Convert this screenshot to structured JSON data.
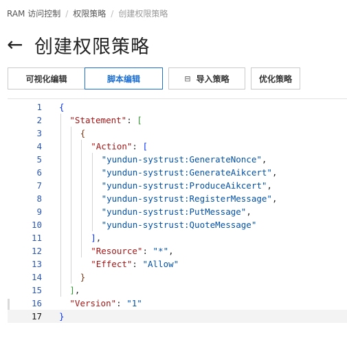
{
  "breadcrumb": {
    "item1": "RAM 访问控制",
    "item2": "权限策略",
    "item3": "创建权限策略",
    "separator": "/"
  },
  "header": {
    "back_arrow": "←",
    "title": "创建权限策略"
  },
  "tabs": {
    "visual_editor": "可视化编辑",
    "script_editor": "脚本编辑",
    "import_policy": "导入策略",
    "import_icon": "⊟",
    "optimize_policy": "优化策略",
    "active": "script_editor"
  },
  "editor": {
    "current_line": 17,
    "lines": [
      {
        "num": "1",
        "tokens": [
          [
            "b1",
            "{"
          ]
        ]
      },
      {
        "num": "2",
        "tokens": [
          [
            "k",
            "\"Statement\""
          ],
          [
            "p",
            ": "
          ],
          [
            "b2",
            "["
          ]
        ]
      },
      {
        "num": "3",
        "tokens": [
          [
            "b3",
            "{"
          ]
        ]
      },
      {
        "num": "4",
        "tokens": [
          [
            "k",
            "\"Action\""
          ],
          [
            "p",
            ": "
          ],
          [
            "b1",
            "["
          ]
        ]
      },
      {
        "num": "5",
        "tokens": [
          [
            "s",
            "\"yundun-systrust:GenerateNonce\""
          ],
          [
            "p",
            ","
          ]
        ]
      },
      {
        "num": "6",
        "tokens": [
          [
            "s",
            "\"yundun-systrust:GenerateAikcert\""
          ],
          [
            "p",
            ","
          ]
        ]
      },
      {
        "num": "7",
        "tokens": [
          [
            "s",
            "\"yundun-systrust:ProduceAikcert\""
          ],
          [
            "p",
            ","
          ]
        ]
      },
      {
        "num": "8",
        "tokens": [
          [
            "s",
            "\"yundun-systrust:RegisterMessage\""
          ],
          [
            "p",
            ","
          ]
        ]
      },
      {
        "num": "9",
        "tokens": [
          [
            "s",
            "\"yundun-systrust:PutMessage\""
          ],
          [
            "p",
            ","
          ]
        ]
      },
      {
        "num": "10",
        "tokens": [
          [
            "s",
            "\"yundun-systrust:QuoteMessage\""
          ]
        ]
      },
      {
        "num": "11",
        "tokens": [
          [
            "b1",
            "]"
          ],
          [
            "p",
            ","
          ]
        ]
      },
      {
        "num": "12",
        "tokens": [
          [
            "k",
            "\"Resource\""
          ],
          [
            "p",
            ": "
          ],
          [
            "s",
            "\"*\""
          ],
          [
            "p",
            ","
          ]
        ]
      },
      {
        "num": "13",
        "tokens": [
          [
            "k",
            "\"Effect\""
          ],
          [
            "p",
            ": "
          ],
          [
            "s",
            "\"Allow\""
          ]
        ]
      },
      {
        "num": "14",
        "tokens": [
          [
            "b3",
            "}"
          ]
        ]
      },
      {
        "num": "15",
        "tokens": [
          [
            "b2",
            "]"
          ],
          [
            "p",
            ","
          ]
        ]
      },
      {
        "num": "16",
        "tokens": [
          [
            "k",
            "\"Version\""
          ],
          [
            "p",
            ": "
          ],
          [
            "s",
            "\"1\""
          ]
        ]
      },
      {
        "num": "17",
        "tokens": [
          [
            "b1",
            "}"
          ]
        ]
      }
    ]
  }
}
